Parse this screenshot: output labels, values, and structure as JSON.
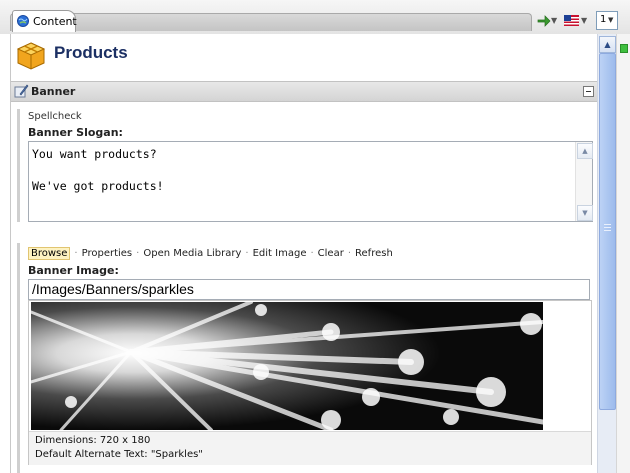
{
  "tabs": [
    {
      "label": "Content",
      "icon": "globe-icon"
    }
  ],
  "toolbar_right": {
    "pager_value": "1"
  },
  "header": {
    "title": "Products",
    "icon": "package-icon"
  },
  "section": {
    "title": "Banner",
    "icon": "quill-icon"
  },
  "slogan_field": {
    "spellcheck_label": "Spellcheck",
    "label": "Banner Slogan:",
    "value": "You want products?\n\nWe've got products!"
  },
  "image_field": {
    "actions": [
      "Browse",
      "Properties",
      "Open Media Library",
      "Edit Image",
      "Clear",
      "Refresh"
    ],
    "active_action": "Browse",
    "label": "Banner Image:",
    "path": "/Images/Banners/sparkles",
    "dimensions": "Dimensions: 720 x 180",
    "alt_text": "Default Alternate Text: \"Sparkles\""
  },
  "colors": {
    "title": "#1b2f63",
    "selected_action_bg": "#fdf2c2",
    "scrollbar_thumb": "#9dbbec"
  }
}
